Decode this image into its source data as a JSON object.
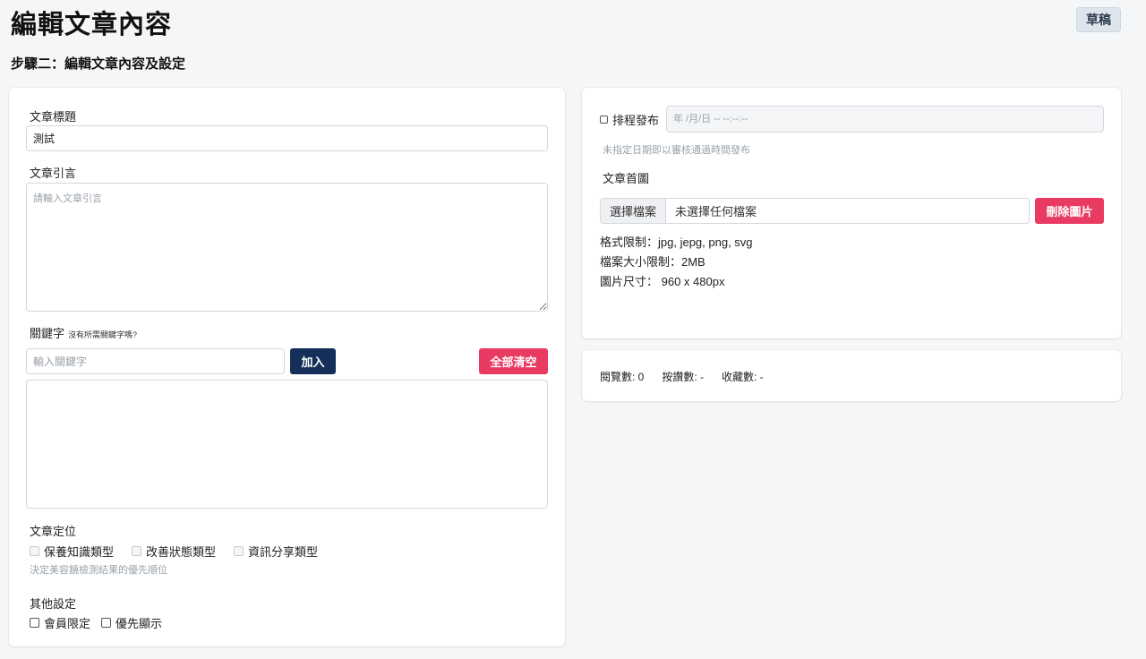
{
  "header": {
    "title": "編輯文章內容",
    "status": "草稿",
    "step": "步驟二：編輯文章內容及設定"
  },
  "form": {
    "title_label": "文章標題",
    "title_value": "測試",
    "excerpt_label": "文章引言",
    "excerpt_placeholder": "請輸入文章引言",
    "keyword_label": "關鍵字",
    "keyword_note": "沒有所需關鍵字嗎?",
    "keyword_placeholder": "輸入關鍵字",
    "add_button": "加入",
    "clear_button": "全部清空",
    "position_label": "文章定位",
    "position_options": [
      "保養知識類型",
      "改善狀態類型",
      "資訊分享類型"
    ],
    "position_hint": "決定美容鏡檢測結果的優先順位",
    "other_label": "其他設定",
    "other_options": [
      "會員限定",
      "優先顯示"
    ]
  },
  "schedule": {
    "label": "排程發布",
    "datetime_placeholder": "年 /月/日 -- --:--:--",
    "hint": "未指定日期即以審核通過時間發布"
  },
  "cover": {
    "label": "文章首圖",
    "choose_button": "選擇檔案",
    "file_status": "未選擇任何檔案",
    "delete_button": "刪除圖片",
    "format_limit": "格式限制：jpg, jepg, png, svg",
    "size_limit": "檔案大小限制：2MB",
    "dimensions": "圖片尺寸： 960 x 480px"
  },
  "stats": {
    "views": "閱覽數: 0",
    "likes": "按讚數: -",
    "favorites": "收藏數: -"
  },
  "colors": {
    "primary": "#14305a",
    "danger": "#e93b62",
    "badge_bg": "#dfe5ec"
  }
}
